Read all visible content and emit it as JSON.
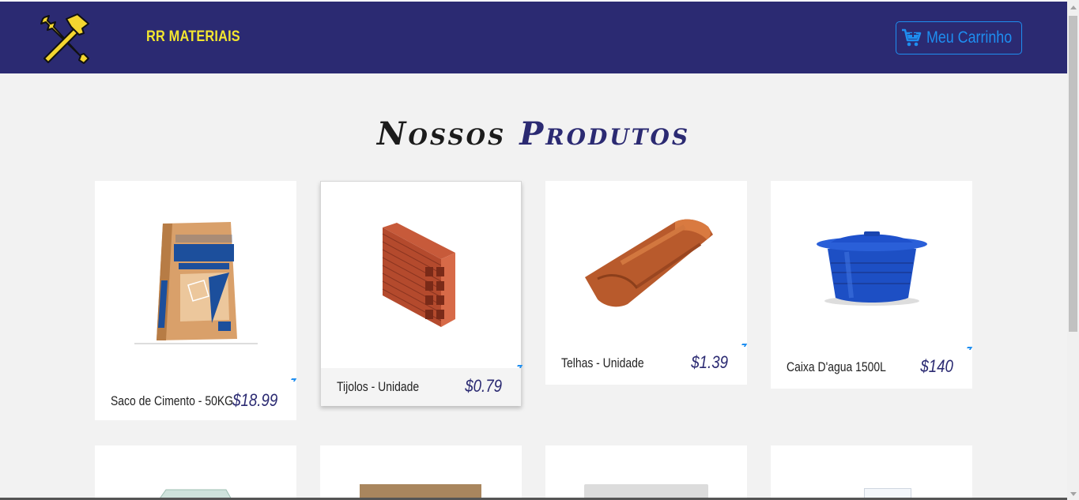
{
  "header": {
    "brand": "RR MATERIAIS",
    "cart_label": "Meu Carrinho",
    "logo_icon": "tools-icon",
    "cart_icon": "cart-icon"
  },
  "section": {
    "title_part1": "Nossos ",
    "title_part2": "Produtos"
  },
  "products": [
    {
      "name": "Saco de Cimento - 50KG",
      "price": "$18.99"
    },
    {
      "name": "Tijolos - Unidade",
      "price": "$0.79"
    },
    {
      "name": "Telhas - Unidade",
      "price": "$1.39"
    },
    {
      "name": "Caixa D'agua 1500L",
      "price": "$140"
    }
  ],
  "colors": {
    "header_bg": "#2b2a72",
    "brand": "#f3e62f",
    "accent": "#1e8ef0",
    "price": "#2b2a72"
  }
}
